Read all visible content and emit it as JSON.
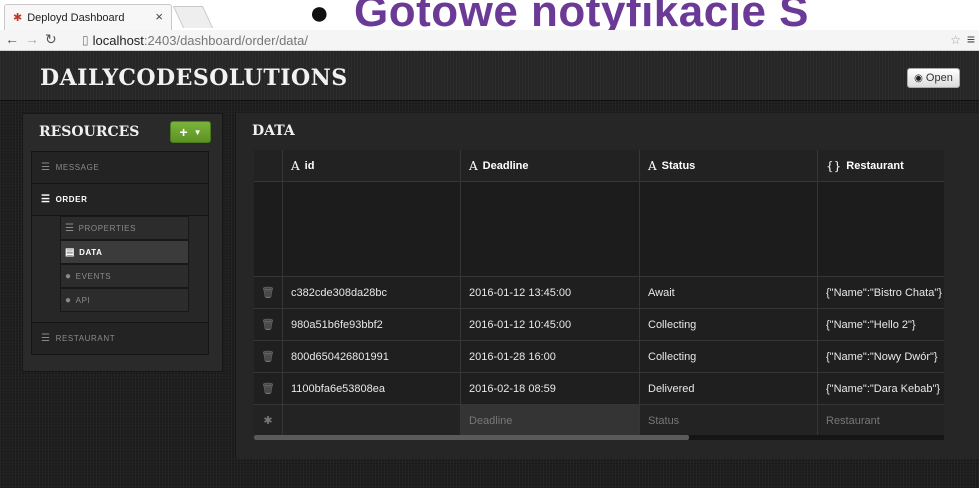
{
  "browser": {
    "tab_title": "Deployd Dashboard",
    "tab_favicon": "deployd-logo-icon",
    "url_host": "localhost",
    "url_path": ":2403/dashboard/order/data/"
  },
  "overlay": {
    "bullet": "●",
    "title": "Gotowe notyfikacje S"
  },
  "header": {
    "brand": "DAILYCODESOLUTIONS",
    "open_label": "Open"
  },
  "sidebar": {
    "title": "RESOURCES",
    "add_label": "+",
    "resources": [
      {
        "label": "MESSAGE",
        "icon": "list-icon",
        "active": false
      },
      {
        "label": "ORDER",
        "icon": "list-icon",
        "active": true
      },
      {
        "label": "RESTAURANT",
        "icon": "list-icon",
        "active": false
      }
    ],
    "order_subitems": [
      {
        "label": "PROPERTIES",
        "icon": "list-icon",
        "active": false
      },
      {
        "label": "DATA",
        "icon": "table-icon",
        "active": true
      },
      {
        "label": "EVENTS",
        "icon": "lightning-icon",
        "active": false
      },
      {
        "label": "API",
        "icon": "info-icon",
        "active": false
      }
    ]
  },
  "main": {
    "title": "DATA",
    "columns": [
      {
        "type_icon": "A",
        "label": "id"
      },
      {
        "type_icon": "A",
        "label": "Deadline"
      },
      {
        "type_icon": "A",
        "label": "Status"
      },
      {
        "type_icon": "{}",
        "label": "Restaurant"
      }
    ],
    "rows": [
      {
        "id": "c382cde308da28bc",
        "deadline": "2016-01-12 13:45:00",
        "status": "Await",
        "restaurant": "{\"Name\":\"Bistro Chata\"}"
      },
      {
        "id": "980a51b6fe93bbf2",
        "deadline": "2016-01-12 10:45:00",
        "status": "Collecting",
        "restaurant": "{\"Name\":\"Hello 2\"}"
      },
      {
        "id": "800d650426801991",
        "deadline": "2016-01-28 16:00",
        "status": "Collecting",
        "restaurant": "{\"Name\":\"Nowy Dwór\"}"
      },
      {
        "id": "1100bfa6e53808ea",
        "deadline": "2016-02-18 08:59",
        "status": "Delivered",
        "restaurant": "{\"Name\":\"Dara Kebab\"}"
      }
    ],
    "new_row": {
      "id_placeholder": "",
      "deadline_placeholder": "Deadline",
      "status_placeholder": "Status",
      "restaurant_placeholder": "Restaurant"
    },
    "horizontal_scroll_fraction": 0.63
  },
  "colors": {
    "accent_green": "#6aa22d",
    "overlay_title": "#6a3a96",
    "background": "#1e1e1e"
  }
}
